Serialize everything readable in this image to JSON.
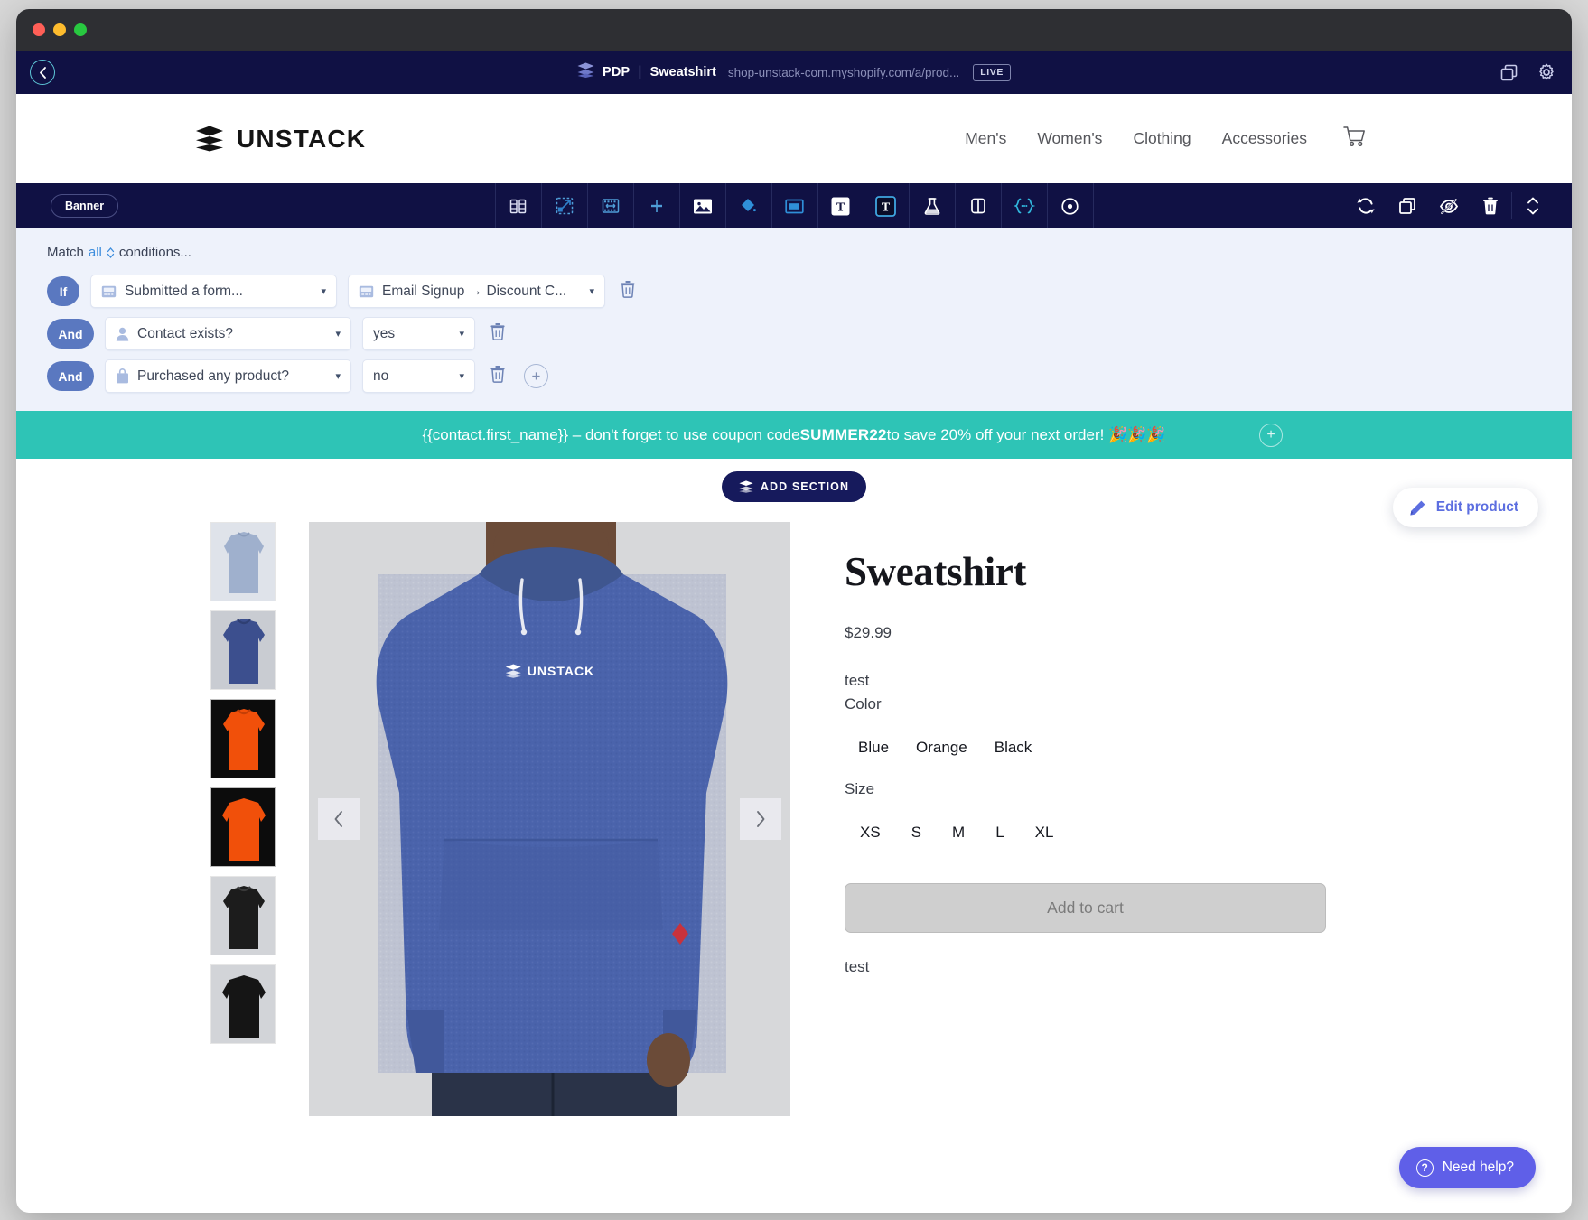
{
  "appbar": {
    "back_icon": "chevron-left-icon",
    "crumb_type": "PDP",
    "divider": "|",
    "crumb_name": "Sweatshirt",
    "url": "shop-unstack-com.myshopify.com/a/prod...",
    "live_badge": "LIVE",
    "right_icons": [
      "duplicate-icon",
      "gear-icon"
    ]
  },
  "site_header": {
    "logo_text": "UNSTACK",
    "nav": [
      {
        "label": "Men's"
      },
      {
        "label": "Women's"
      },
      {
        "label": "Clothing"
      },
      {
        "label": "Accessories"
      }
    ],
    "cart_icon": "shopping-cart-icon"
  },
  "toolbar": {
    "tag_label": "Banner",
    "tools": [
      {
        "name": "columns-icon"
      },
      {
        "name": "resize-icon"
      },
      {
        "name": "video-icon"
      },
      {
        "name": "divider-icon"
      },
      {
        "name": "image-icon"
      },
      {
        "name": "color-fill-icon"
      },
      {
        "name": "form-icon"
      },
      {
        "name": "text-light-icon"
      },
      {
        "name": "text-dark-icon"
      },
      {
        "name": "experiment-flask-icon"
      },
      {
        "name": "split-panel-icon"
      },
      {
        "name": "code-embed-icon"
      },
      {
        "name": "target-icon"
      }
    ],
    "actions": [
      {
        "name": "refresh-icon"
      },
      {
        "name": "duplicate-icon"
      },
      {
        "name": "hide-eye-icon"
      },
      {
        "name": "delete-trash-icon"
      },
      {
        "name": "move-updown-icon"
      }
    ]
  },
  "conditions": {
    "match_prefix": "Match",
    "match_value": "all",
    "match_suffix": "conditions...",
    "rows": [
      {
        "connector": "If",
        "field_icon": "form-icon",
        "field": "Submitted a form...",
        "value_icon": "form-icon",
        "value": "Email Signup → Discount C...",
        "has_value_icon": true,
        "delete_icon": "trash-icon",
        "add_icon": null
      },
      {
        "connector": "And",
        "field_icon": "person-icon",
        "field": "Contact exists?",
        "value": "yes",
        "has_value_icon": false,
        "delete_icon": "trash-icon",
        "add_icon": null
      },
      {
        "connector": "And",
        "field_icon": "shopping-bag-icon",
        "field": "Purchased any product?",
        "value": "no",
        "has_value_icon": false,
        "delete_icon": "trash-icon",
        "add_icon": "plus-icon"
      }
    ]
  },
  "banner": {
    "text_before": "{{contact.first_name}} – don't forget to use coupon code ",
    "code": "SUMMER22",
    "text_after": " to save 20% off your next order! 🎉🎉🎉",
    "bg_color": "#2ec4b6",
    "add_icon": "plus-icon"
  },
  "add_section": {
    "label": "ADD SECTION",
    "icon": "stack-icon"
  },
  "edit_product": {
    "label": "Edit product",
    "icon": "pencil-icon"
  },
  "product": {
    "title": "Sweatshirt",
    "price": "$29.99",
    "description": "test",
    "color_label": "Color",
    "colors": [
      "Blue",
      "Orange",
      "Black"
    ],
    "size_label": "Size",
    "sizes": [
      "XS",
      "S",
      "M",
      "L",
      "XL"
    ],
    "add_to_cart": "Add to cart",
    "footer_text": "test",
    "hero_logo_text": "UNSTACK",
    "prev_icon": "chevron-left-icon",
    "next_icon": "chevron-right-icon",
    "thumbnails": [
      {
        "color": "#9fb0cd",
        "label": "light-blue-hoodie"
      },
      {
        "color": "#3c4f8e",
        "label": "navy-hoodie-front"
      },
      {
        "color": "#f1500a",
        "label": "orange-hoodie-front"
      },
      {
        "color": "#f1500a",
        "label": "orange-hoodie-back"
      },
      {
        "color": "#1c1c1c",
        "label": "black-hoodie-front"
      },
      {
        "color": "#151515",
        "label": "black-hoodie-back"
      }
    ]
  },
  "need_help": {
    "label": "Need help?",
    "icon": "question-icon",
    "color": "#5f5fe8"
  }
}
